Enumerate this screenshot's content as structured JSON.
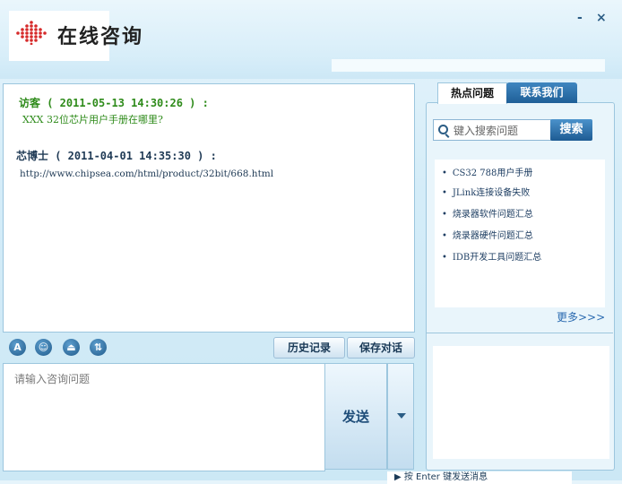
{
  "app": {
    "title": "在线咨询",
    "minimize": "-",
    "close": "×"
  },
  "chat": {
    "messages": [
      {
        "header": "访客 ( 2011-05-13  14:30:26 ) :",
        "text": "XXX 32位芯片用户手册在哪里?"
      },
      {
        "header": "芯博士 ( 2011-04-01  14:35:30 ) :",
        "text": "http://www.chipsea.com/html/product/32bit/668.html"
      }
    ]
  },
  "toolbar": {
    "icons": [
      "font-icon",
      "emoji-icon",
      "screenshot-icon",
      "file-transfer-icon"
    ],
    "history_label": "历史记录",
    "save_label": "保存对话"
  },
  "input": {
    "placeholder": "请输入咨询问题"
  },
  "send": {
    "label": "发送"
  },
  "side_panel": {
    "tabs": [
      {
        "label": "热点问题"
      },
      {
        "label": "联系我们"
      }
    ],
    "search": {
      "placeholder": "键入搜索问题",
      "button_label": "搜索"
    },
    "questions": [
      "CS32 788用户手册",
      "JLink连接设备失败",
      "烧录器软件问题汇总",
      "烧录器硬件问题汇总",
      "IDB开发工具问题汇总"
    ],
    "more_label": "更多>>>"
  },
  "footer": {
    "text": "▶ 按 Enter 键发送消息"
  },
  "colors": {
    "accent": "#1f5f97",
    "visitor_text": "#2e8b1a",
    "expert_text": "#1f3a55"
  }
}
